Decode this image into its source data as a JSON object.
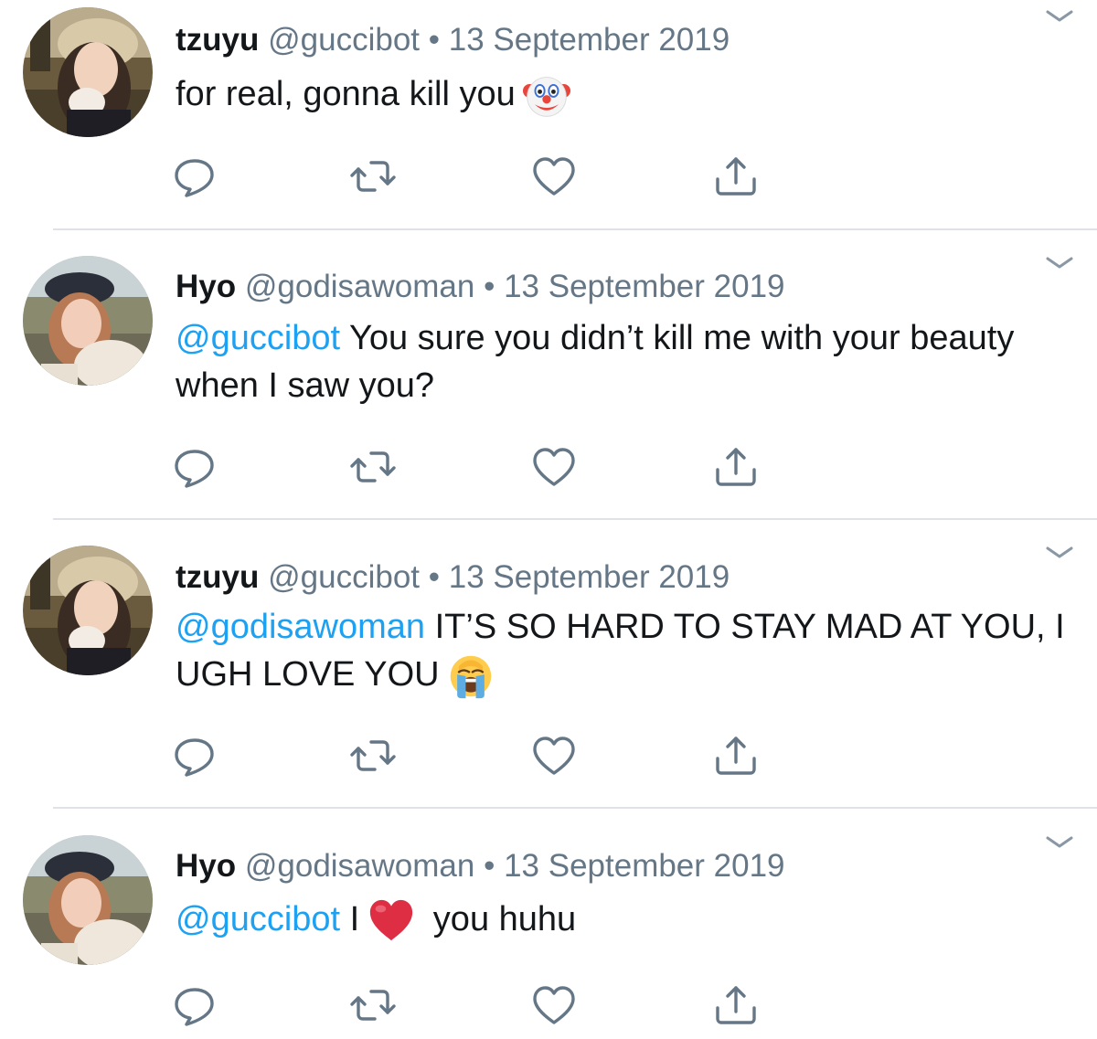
{
  "tweets": [
    {
      "name": "tzuyu",
      "handle": "@guccibot",
      "date": "• 13 September 2019",
      "mention": "",
      "text": "for real, gonna kill you",
      "emoji": "clown-face-emoji",
      "avatar": "tzuyu-avatar"
    },
    {
      "name": "Hyo",
      "handle": "@godisawoman",
      "date": "• 13 September 2019",
      "mention": "@guccibot",
      "text": " You sure you didn’t kill me with your beauty when I saw you?",
      "emoji": "",
      "avatar": "hyo-avatar"
    },
    {
      "name": "tzuyu",
      "handle": "@guccibot",
      "date": "• 13 September 2019",
      "mention": "@godisawoman",
      "text": " IT’S SO HARD TO STAY MAD AT YOU, I UGH LOVE YOU",
      "emoji": "loudly-crying-face-emoji",
      "avatar": "tzuyu-avatar"
    },
    {
      "name": "Hyo",
      "handle": "@godisawoman",
      "date": "• 13 September 2019",
      "mention": "@guccibot",
      "text": " I",
      "emoji": "red-heart-emoji",
      "text_after": " you huhu",
      "avatar": "hyo-avatar"
    }
  ],
  "action_icons": [
    "reply-icon",
    "retweet-icon",
    "like-icon",
    "share-icon"
  ],
  "menu_icon": "chevron-down-icon",
  "colors": {
    "name": "#14171a",
    "meta": "#657786",
    "mention": "#1da1f2",
    "icon": "#657786",
    "divider": "#dfe3e7",
    "background": "#ffffff"
  }
}
